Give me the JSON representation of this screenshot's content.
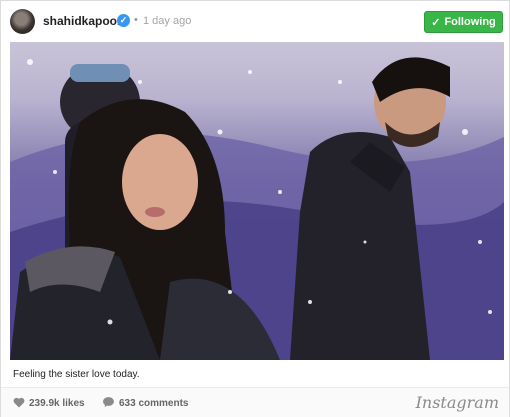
{
  "post": {
    "username": "shahidkapoor",
    "verified_icon": "verified-badge-icon",
    "separator": "•",
    "time_ago": "1 day ago",
    "follow_button": {
      "label": "Following",
      "icon": "check-icon",
      "color": "#3ab548"
    },
    "caption": "Feeling the sister love today.",
    "likes": "239.9k likes",
    "comments": "633 comments",
    "brand": "Instagram"
  }
}
